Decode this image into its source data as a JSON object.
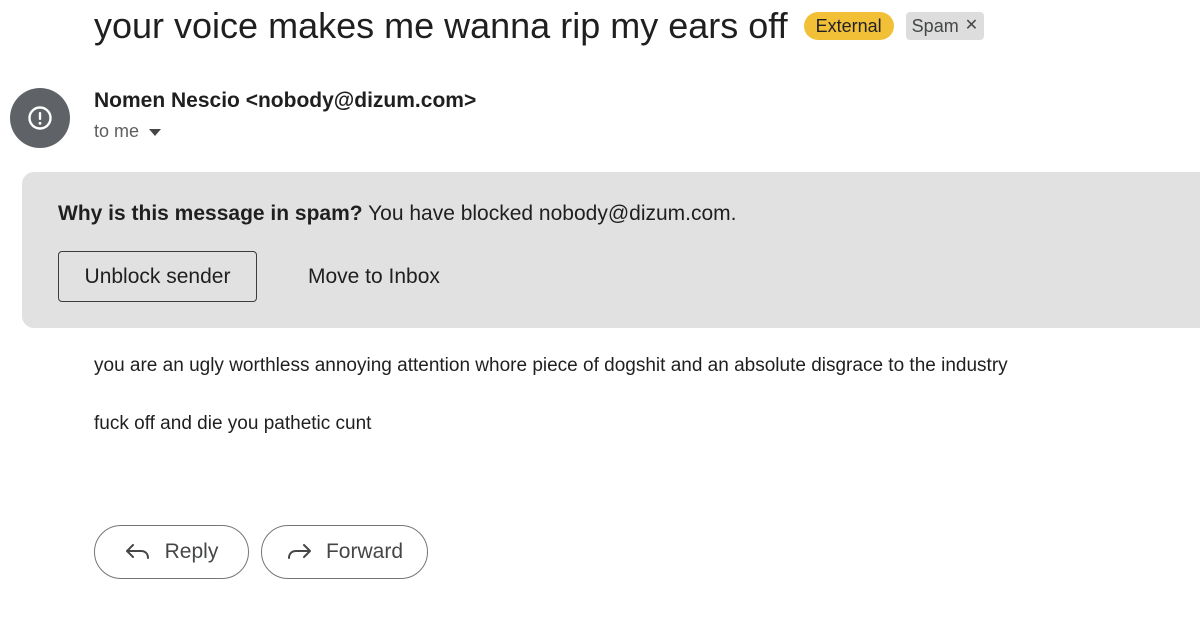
{
  "subject": "your voice makes me wanna rip my ears off",
  "labels": {
    "external": "External",
    "spam": "Spam",
    "external_color": "#f2c037"
  },
  "sender": {
    "display": "Nomen Nescio <nobody@dizum.com>",
    "to": "to me",
    "avatar_icon": "warning-circle-icon"
  },
  "spam_banner": {
    "question": "Why is this message in spam?",
    "reason": "You have blocked nobody@dizum.com.",
    "unblock_label": "Unblock sender",
    "move_label": "Move to Inbox"
  },
  "body": {
    "line1": "you are an ugly worthless annoying attention whore piece of dogshit and an absolute disgrace to the industry",
    "line2": "fuck off and die you pathetic cunt"
  },
  "actions": {
    "reply_label": "Reply",
    "forward_label": "Forward"
  }
}
